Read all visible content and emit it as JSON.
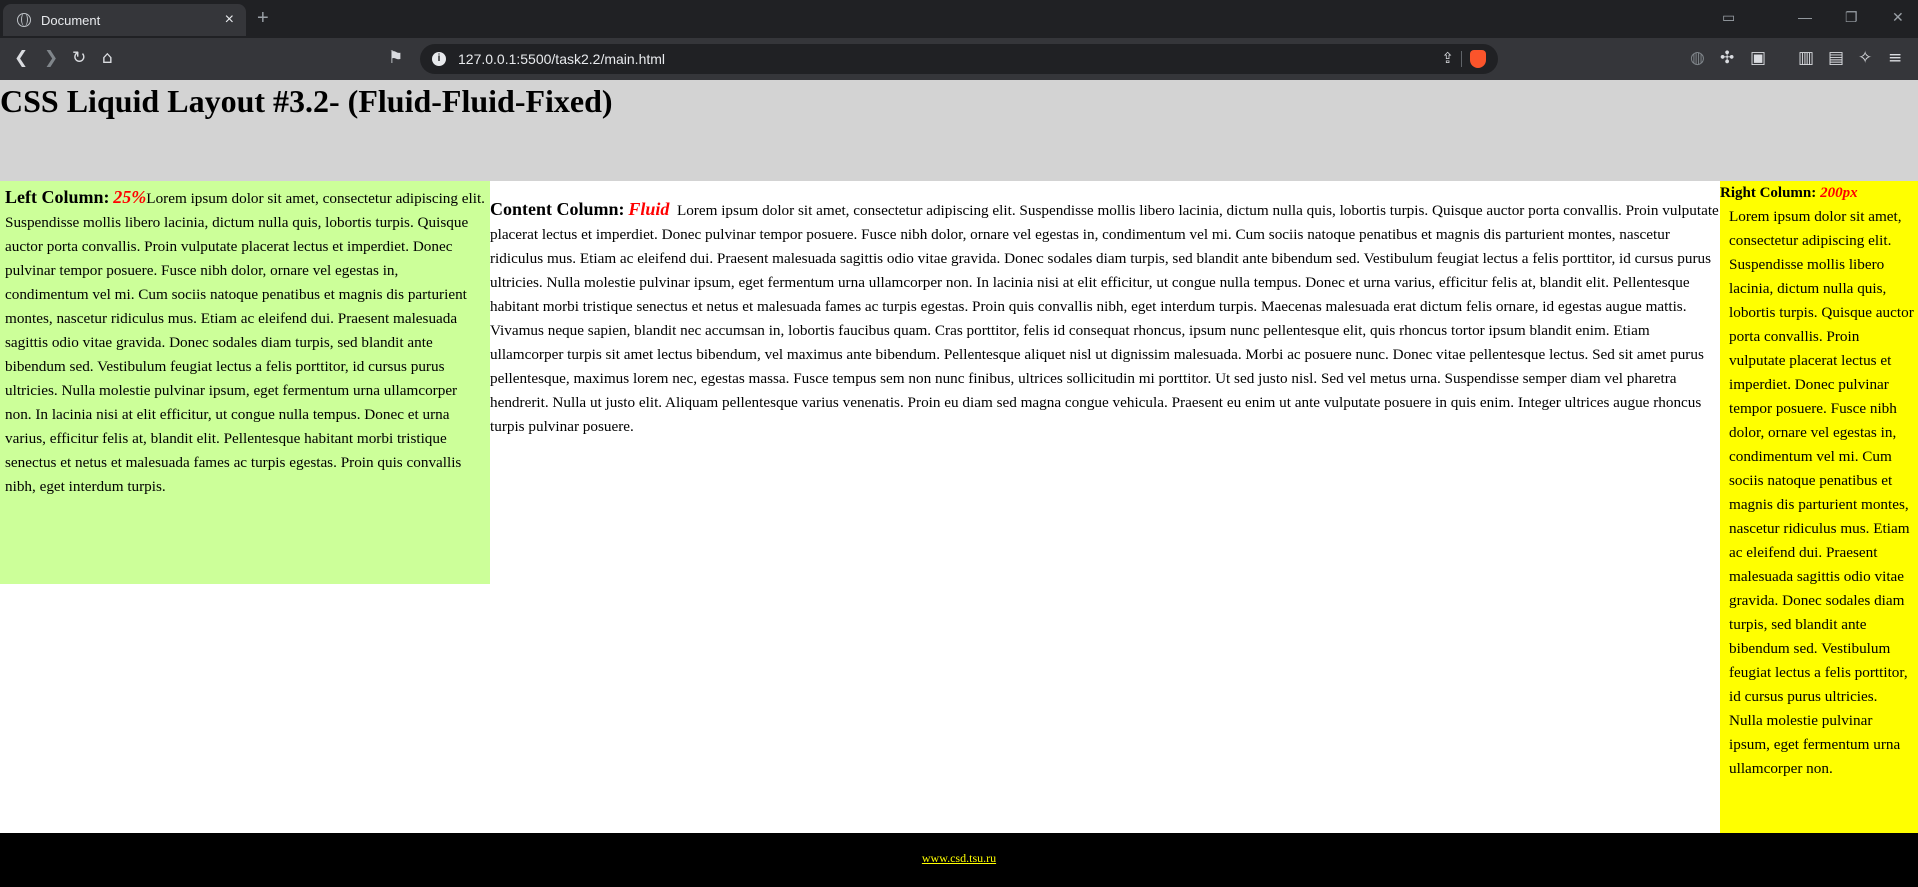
{
  "browser": {
    "tab_title": "Document",
    "tab_close": "×",
    "new_tab": "+",
    "url": "127.0.0.1:5500/task2.2/main.html"
  },
  "page": {
    "header_title": "CSS Liquid Layout #3.2- (Fluid-Fluid-Fixed)",
    "left": {
      "label": "Left Column:",
      "accent": "25%",
      "text": "Lorem ipsum dolor sit amet, consectetur adipiscing elit. Suspendisse mollis libero lacinia, dictum nulla quis, lobortis turpis. Quisque auctor porta convallis. Proin vulputate placerat lectus et imperdiet. Donec pulvinar tempor posuere. Fusce nibh dolor, ornare vel egestas in, condimentum vel mi. Cum sociis natoque penatibus et magnis dis parturient montes, nascetur ridiculus mus. Etiam ac eleifend dui. Praesent malesuada sagittis odio vitae gravida. Donec sodales diam turpis, sed blandit ante bibendum sed. Vestibulum feugiat lectus a felis porttitor, id cursus purus ultricies. Nulla molestie pulvinar ipsum, eget fermentum urna ullamcorper non. In lacinia nisi at elit efficitur, ut congue nulla tempus. Donec et urna varius, efficitur felis at, blandit elit. Pellentesque habitant morbi tristique senectus et netus et malesuada fames ac turpis egestas. Proin quis convallis nibh, eget interdum turpis."
    },
    "content": {
      "label": "Content Column:",
      "accent": "Fluid",
      "text": "Lorem ipsum dolor sit amet, consectetur adipiscing elit. Suspendisse mollis libero lacinia, dictum nulla quis, lobortis turpis. Quisque auctor porta convallis. Proin vulputate placerat lectus et imperdiet. Donec pulvinar tempor posuere. Fusce nibh dolor, ornare vel egestas in, condimentum vel mi. Cum sociis natoque penatibus et magnis dis parturient montes, nascetur ridiculus mus. Etiam ac eleifend dui. Praesent malesuada sagittis odio vitae gravida. Donec sodales diam turpis, sed blandit ante bibendum sed. Vestibulum feugiat lectus a felis porttitor, id cursus purus ultricies. Nulla molestie pulvinar ipsum, eget fermentum urna ullamcorper non. In lacinia nisi at elit efficitur, ut congue nulla tempus. Donec et urna varius, efficitur felis at, blandit elit. Pellentesque habitant morbi tristique senectus et netus et malesuada fames ac turpis egestas. Proin quis convallis nibh, eget interdum turpis. Maecenas malesuada erat dictum felis ornare, id egestas augue mattis. Vivamus neque sapien, blandit nec accumsan in, lobortis faucibus quam. Cras porttitor, felis id consequat rhoncus, ipsum nunc pellentesque elit, quis rhoncus tortor ipsum blandit enim. Etiam ullamcorper turpis sit amet lectus bibendum, vel maximus ante bibendum. Pellentesque aliquet nisl ut dignissim malesuada. Morbi ac posuere nunc. Donec vitae pellentesque lectus. Sed sit amet purus pellentesque, maximus lorem nec, egestas massa. Fusce tempus sem non nunc finibus, ultrices sollicitudin mi porttitor. Ut sed justo nisl. Sed vel metus urna. Suspendisse semper diam vel pharetra hendrerit. Nulla ut justo elit. Aliquam pellentesque varius venenatis. Proin eu diam sed magna congue vehicula. Praesent eu enim ut ante vulputate posuere in quis enim. Integer ultrices augue rhoncus turpis pulvinar posuere."
    },
    "right": {
      "label": "Right Column:",
      "accent": "200px",
      "text": "Lorem ipsum dolor sit amet, consectetur adipiscing elit. Suspendisse mollis libero lacinia, dictum nulla quis, lobortis turpis. Quisque auctor porta convallis. Proin vulputate placerat lectus et imperdiet. Donec pulvinar tempor posuere. Fusce nibh dolor, ornare vel egestas in, condimentum vel mi. Cum sociis natoque penatibus et magnis dis parturient montes, nascetur ridiculus mus. Etiam ac eleifend dui. Praesent malesuada sagittis odio vitae gravida. Donec sodales diam turpis, sed blandit ante bibendum sed. Vestibulum feugiat lectus a felis porttitor, id cursus purus ultricies. Nulla molestie pulvinar ipsum, eget fermentum urna ullamcorper non."
    },
    "footer_link": "www.csd.tsu.ru"
  },
  "colors": {
    "header_bg": "#d3d3d3",
    "left_bg": "#ccff99",
    "right_bg": "#ffff00",
    "accent": "#ff0000",
    "footer_bg": "#000000",
    "footer_link": "#ffff00"
  }
}
